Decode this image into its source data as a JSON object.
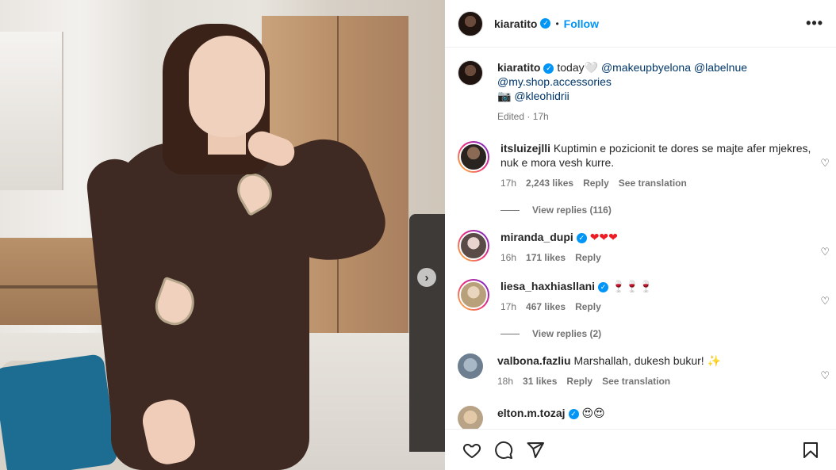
{
  "post": {
    "author": "kiaratito",
    "follow_label": "Follow",
    "more_label": "•••",
    "next_label": "›"
  },
  "caption": {
    "author": "kiaratito",
    "text_prefix": "today🤍 ",
    "mentions_line1": [
      "@makeupbyelona",
      "@labelnue"
    ],
    "mention_line2": "@my.shop.accessories",
    "camera": "📷",
    "mention_line3": "@kleohidrii",
    "edited": "Edited · 17h"
  },
  "comments": [
    {
      "username": "itsluizejlli",
      "text": "Kuptimin e pozicionit te dores se majte afer mjekres, nuk e mora vesh kurre.",
      "time": "17h",
      "likes": "2,243 likes",
      "reply": "Reply",
      "translate": "See translation",
      "replies": "View replies (116)"
    },
    {
      "username": "miranda_dupi",
      "text": "❤❤❤",
      "time": "16h",
      "likes": "171 likes",
      "reply": "Reply"
    },
    {
      "username": "liesa_haxhiasllani",
      "text": "🍷🍷🍷",
      "time": "17h",
      "likes": "467 likes",
      "reply": "Reply",
      "replies": "View replies (2)"
    },
    {
      "username": "valbona.fazliu",
      "text": "Marshallah, dukesh bukur! ✨",
      "time": "18h",
      "likes": "31 likes",
      "reply": "Reply",
      "translate": "See translation"
    },
    {
      "username": "elton.m.tozaj",
      "text": "😍😍"
    }
  ],
  "colors": {
    "link": "#00376b",
    "follow": "#0095f6",
    "verified": "#0095f6"
  }
}
